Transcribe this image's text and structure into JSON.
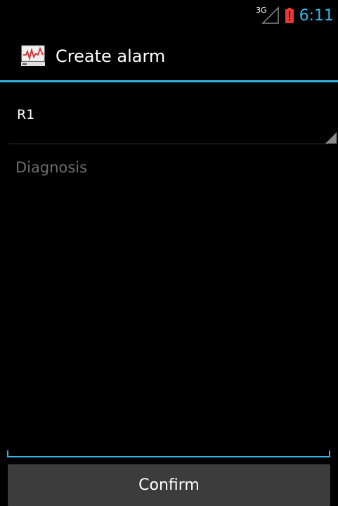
{
  "status_bar": {
    "network_type": "3G",
    "time": "6:11",
    "icons": [
      "signal-icon",
      "battery-alert-icon"
    ]
  },
  "action_bar": {
    "app_icon": "monitor-graph-icon",
    "title": "Create alarm"
  },
  "form": {
    "spinner_value": "R1",
    "diagnosis_placeholder": "Diagnosis",
    "diagnosis_value": ""
  },
  "confirm_button": {
    "label": "Confirm"
  },
  "colors": {
    "accent": "#33b5e5",
    "background": "#000000",
    "button": "#3c3c3c",
    "hint_text": "#6e6e6e",
    "battery_alert": "#e53935"
  }
}
